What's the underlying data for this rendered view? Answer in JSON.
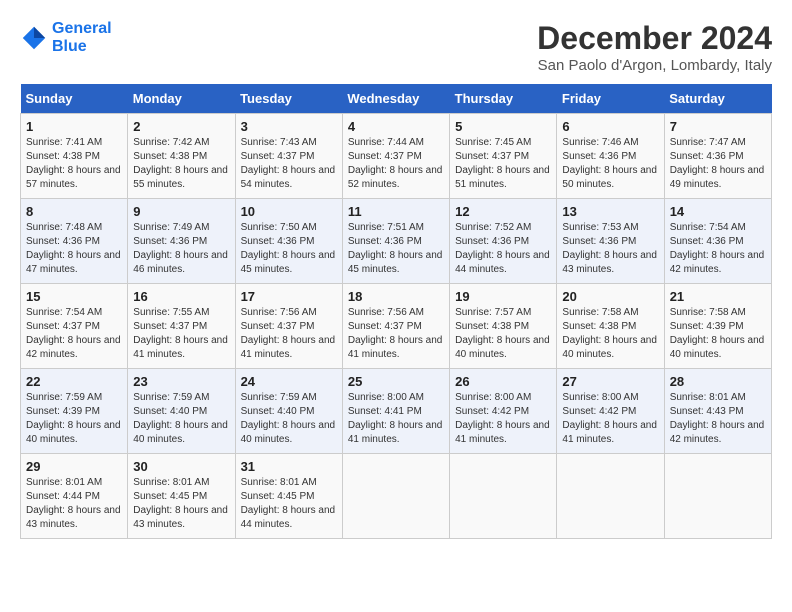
{
  "header": {
    "logo_line1": "General",
    "logo_line2": "Blue",
    "title": "December 2024",
    "subtitle": "San Paolo d'Argon, Lombardy, Italy"
  },
  "weekdays": [
    "Sunday",
    "Monday",
    "Tuesday",
    "Wednesday",
    "Thursday",
    "Friday",
    "Saturday"
  ],
  "weeks": [
    [
      {
        "day": "1",
        "sunrise": "Sunrise: 7:41 AM",
        "sunset": "Sunset: 4:38 PM",
        "daylight": "Daylight: 8 hours and 57 minutes."
      },
      {
        "day": "2",
        "sunrise": "Sunrise: 7:42 AM",
        "sunset": "Sunset: 4:38 PM",
        "daylight": "Daylight: 8 hours and 55 minutes."
      },
      {
        "day": "3",
        "sunrise": "Sunrise: 7:43 AM",
        "sunset": "Sunset: 4:37 PM",
        "daylight": "Daylight: 8 hours and 54 minutes."
      },
      {
        "day": "4",
        "sunrise": "Sunrise: 7:44 AM",
        "sunset": "Sunset: 4:37 PM",
        "daylight": "Daylight: 8 hours and 52 minutes."
      },
      {
        "day": "5",
        "sunrise": "Sunrise: 7:45 AM",
        "sunset": "Sunset: 4:37 PM",
        "daylight": "Daylight: 8 hours and 51 minutes."
      },
      {
        "day": "6",
        "sunrise": "Sunrise: 7:46 AM",
        "sunset": "Sunset: 4:36 PM",
        "daylight": "Daylight: 8 hours and 50 minutes."
      },
      {
        "day": "7",
        "sunrise": "Sunrise: 7:47 AM",
        "sunset": "Sunset: 4:36 PM",
        "daylight": "Daylight: 8 hours and 49 minutes."
      }
    ],
    [
      {
        "day": "8",
        "sunrise": "Sunrise: 7:48 AM",
        "sunset": "Sunset: 4:36 PM",
        "daylight": "Daylight: 8 hours and 47 minutes."
      },
      {
        "day": "9",
        "sunrise": "Sunrise: 7:49 AM",
        "sunset": "Sunset: 4:36 PM",
        "daylight": "Daylight: 8 hours and 46 minutes."
      },
      {
        "day": "10",
        "sunrise": "Sunrise: 7:50 AM",
        "sunset": "Sunset: 4:36 PM",
        "daylight": "Daylight: 8 hours and 45 minutes."
      },
      {
        "day": "11",
        "sunrise": "Sunrise: 7:51 AM",
        "sunset": "Sunset: 4:36 PM",
        "daylight": "Daylight: 8 hours and 45 minutes."
      },
      {
        "day": "12",
        "sunrise": "Sunrise: 7:52 AM",
        "sunset": "Sunset: 4:36 PM",
        "daylight": "Daylight: 8 hours and 44 minutes."
      },
      {
        "day": "13",
        "sunrise": "Sunrise: 7:53 AM",
        "sunset": "Sunset: 4:36 PM",
        "daylight": "Daylight: 8 hours and 43 minutes."
      },
      {
        "day": "14",
        "sunrise": "Sunrise: 7:54 AM",
        "sunset": "Sunset: 4:36 PM",
        "daylight": "Daylight: 8 hours and 42 minutes."
      }
    ],
    [
      {
        "day": "15",
        "sunrise": "Sunrise: 7:54 AM",
        "sunset": "Sunset: 4:37 PM",
        "daylight": "Daylight: 8 hours and 42 minutes."
      },
      {
        "day": "16",
        "sunrise": "Sunrise: 7:55 AM",
        "sunset": "Sunset: 4:37 PM",
        "daylight": "Daylight: 8 hours and 41 minutes."
      },
      {
        "day": "17",
        "sunrise": "Sunrise: 7:56 AM",
        "sunset": "Sunset: 4:37 PM",
        "daylight": "Daylight: 8 hours and 41 minutes."
      },
      {
        "day": "18",
        "sunrise": "Sunrise: 7:56 AM",
        "sunset": "Sunset: 4:37 PM",
        "daylight": "Daylight: 8 hours and 41 minutes."
      },
      {
        "day": "19",
        "sunrise": "Sunrise: 7:57 AM",
        "sunset": "Sunset: 4:38 PM",
        "daylight": "Daylight: 8 hours and 40 minutes."
      },
      {
        "day": "20",
        "sunrise": "Sunrise: 7:58 AM",
        "sunset": "Sunset: 4:38 PM",
        "daylight": "Daylight: 8 hours and 40 minutes."
      },
      {
        "day": "21",
        "sunrise": "Sunrise: 7:58 AM",
        "sunset": "Sunset: 4:39 PM",
        "daylight": "Daylight: 8 hours and 40 minutes."
      }
    ],
    [
      {
        "day": "22",
        "sunrise": "Sunrise: 7:59 AM",
        "sunset": "Sunset: 4:39 PM",
        "daylight": "Daylight: 8 hours and 40 minutes."
      },
      {
        "day": "23",
        "sunrise": "Sunrise: 7:59 AM",
        "sunset": "Sunset: 4:40 PM",
        "daylight": "Daylight: 8 hours and 40 minutes."
      },
      {
        "day": "24",
        "sunrise": "Sunrise: 7:59 AM",
        "sunset": "Sunset: 4:40 PM",
        "daylight": "Daylight: 8 hours and 40 minutes."
      },
      {
        "day": "25",
        "sunrise": "Sunrise: 8:00 AM",
        "sunset": "Sunset: 4:41 PM",
        "daylight": "Daylight: 8 hours and 41 minutes."
      },
      {
        "day": "26",
        "sunrise": "Sunrise: 8:00 AM",
        "sunset": "Sunset: 4:42 PM",
        "daylight": "Daylight: 8 hours and 41 minutes."
      },
      {
        "day": "27",
        "sunrise": "Sunrise: 8:00 AM",
        "sunset": "Sunset: 4:42 PM",
        "daylight": "Daylight: 8 hours and 41 minutes."
      },
      {
        "day": "28",
        "sunrise": "Sunrise: 8:01 AM",
        "sunset": "Sunset: 4:43 PM",
        "daylight": "Daylight: 8 hours and 42 minutes."
      }
    ],
    [
      {
        "day": "29",
        "sunrise": "Sunrise: 8:01 AM",
        "sunset": "Sunset: 4:44 PM",
        "daylight": "Daylight: 8 hours and 43 minutes."
      },
      {
        "day": "30",
        "sunrise": "Sunrise: 8:01 AM",
        "sunset": "Sunset: 4:45 PM",
        "daylight": "Daylight: 8 hours and 43 minutes."
      },
      {
        "day": "31",
        "sunrise": "Sunrise: 8:01 AM",
        "sunset": "Sunset: 4:45 PM",
        "daylight": "Daylight: 8 hours and 44 minutes."
      },
      null,
      null,
      null,
      null
    ]
  ]
}
